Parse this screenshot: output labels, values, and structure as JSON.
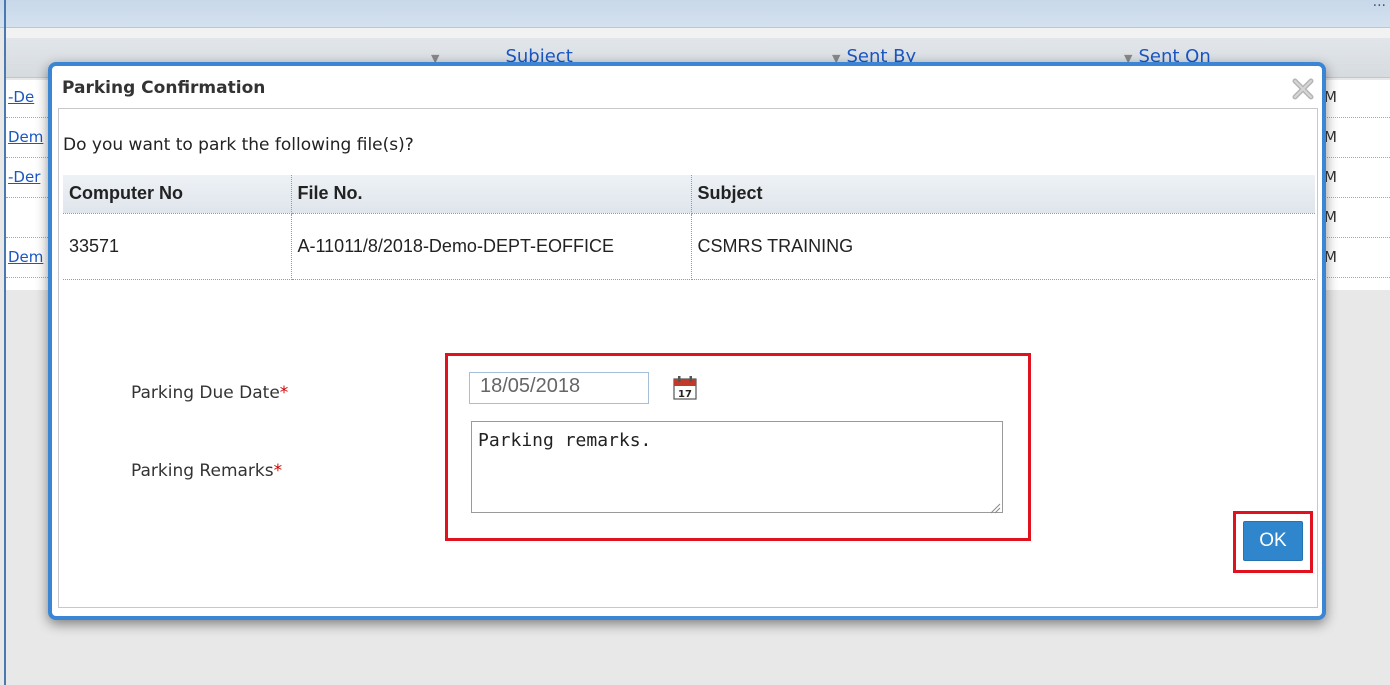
{
  "background": {
    "header_right_text": "...",
    "columns": [
      {
        "label": "Subject"
      },
      {
        "label": "Sent By"
      },
      {
        "label": "Sent On"
      }
    ],
    "row_links": [
      "-De",
      "Dem",
      "-Der",
      "",
      "Dem"
    ],
    "row_right": [
      "M",
      "M",
      "M",
      "M",
      "M"
    ]
  },
  "modal": {
    "title": "Parking Confirmation",
    "question": "Do you want to park the following file(s)?",
    "table": {
      "headers": [
        "Computer No",
        "File No.",
        "Subject"
      ],
      "rows": [
        [
          "33571",
          "A-11011/8/2018-Demo-DEPT-EOFFICE",
          "CSMRS TRAINING"
        ]
      ]
    },
    "form": {
      "due_date_label": "Parking Due Date",
      "due_date_value": "18/05/2018",
      "remarks_label": "Parking Remarks",
      "remarks_value": "Parking remarks.",
      "required_mark": "*",
      "calendar_day": "17"
    },
    "ok_label": "OK",
    "close_icon": "close-icon",
    "calendar_icon": "calendar-icon"
  },
  "colors": {
    "accent": "#2f86cc",
    "modal_border": "#3a86d4",
    "highlight": "#e0121e",
    "link": "#1a56c4"
  }
}
